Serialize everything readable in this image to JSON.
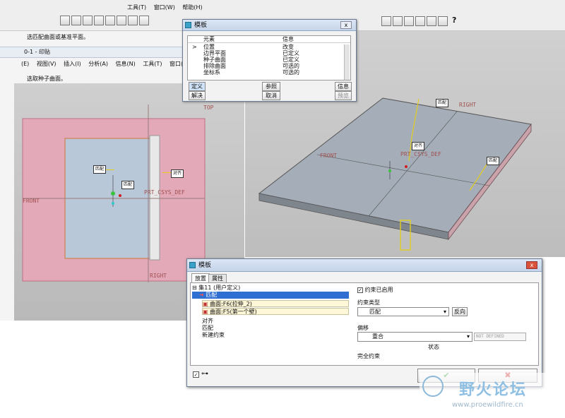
{
  "top_menu": {
    "tool": "工具(T)",
    "window": "窗口(W)",
    "help": "帮助(H)"
  },
  "back_window": {
    "hint1": "选匹配曲面或基准平面。",
    "title": "0-1 - 印贴",
    "menu": [
      "(E)",
      "视图(V)",
      "插入(I)",
      "分析(A)",
      "信息(N)",
      "工具(T)",
      "窗口(W)"
    ],
    "hint2": "选取种子曲面。"
  },
  "left_view": {
    "labels": {
      "top": "TOP",
      "front": "FRONT",
      "right": "RIGHT",
      "csys": "PRT_CSYS_DEF"
    },
    "ann": {
      "match": "匹配",
      "align": "对齐",
      "match2": "匹配"
    }
  },
  "right_view": {
    "labels": {
      "right": "RIGHT",
      "front": "FRONT",
      "csys": "PRT_CSYS_DEF"
    },
    "ann": {
      "match": "匹配",
      "align": "对齐",
      "match2": "匹配"
    }
  },
  "dialog_top": {
    "title": "模板",
    "col_element": "元素",
    "col_info": "信息",
    "rows": [
      {
        "e": "位置",
        "i": "改变"
      },
      {
        "e": "边界平面",
        "i": "已定义"
      },
      {
        "e": "种子曲面",
        "i": "已定义"
      },
      {
        "e": "排除曲面",
        "i": "可选的"
      },
      {
        "e": "坐标系",
        "i": "可选的"
      }
    ],
    "buttons": {
      "define": "定义",
      "ref": "参照",
      "info": "信息",
      "cancel_solve": "解决",
      "cancel": "取消",
      "preview": "预览"
    }
  },
  "dialog_main": {
    "title": "模板",
    "tabs": [
      "放置",
      "属性"
    ],
    "set": "集11 (用户定义)",
    "selected": "匹配",
    "ref1": "曲面:F6(拉伸_2)",
    "ref2": "曲面:F5(第一个壁)",
    "others": [
      "对齐",
      "匹配",
      "新建约束"
    ],
    "enabled": "约束已启用",
    "type_label": "约束类型",
    "type_value": "匹配",
    "reverse": "反向",
    "offset_label": "偏移",
    "offset_value": "重合",
    "not_defined": "NOT DEFINED",
    "status_label": "状态",
    "status_value": "完全约束",
    "ok": "✔",
    "close": "✖"
  },
  "watermark": {
    "title": "野火论坛",
    "url": "www.proewildfire.cn"
  }
}
